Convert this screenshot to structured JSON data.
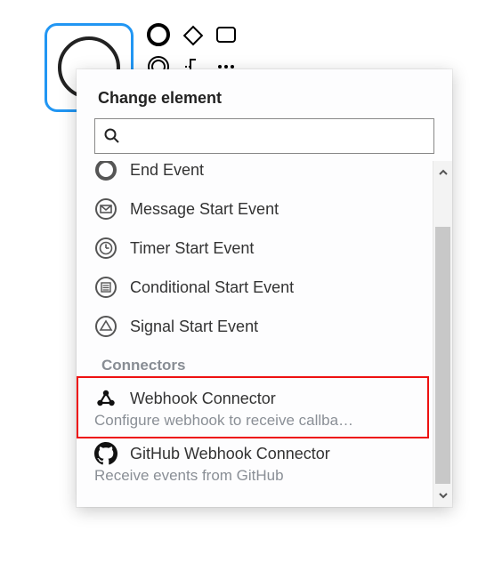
{
  "popup": {
    "title": "Change element",
    "search_placeholder": "",
    "events": [
      {
        "id": "end-event",
        "label": "End Event",
        "icon": "end-event-icon"
      },
      {
        "id": "message-start-event",
        "label": "Message Start Event",
        "icon": "message-start-event-icon"
      },
      {
        "id": "timer-start-event",
        "label": "Timer Start Event",
        "icon": "timer-start-event-icon"
      },
      {
        "id": "conditional-start-event",
        "label": "Conditional Start Event",
        "icon": "conditional-start-event-icon"
      },
      {
        "id": "signal-start-event",
        "label": "Signal Start Event",
        "icon": "signal-start-event-icon"
      }
    ],
    "connectors_section_title": "Connectors",
    "connectors": [
      {
        "id": "webhook-connector",
        "label": "Webhook Connector",
        "desc": "Configure webhook to receive callba…",
        "icon": "webhook-icon"
      },
      {
        "id": "github-webhook-connector",
        "label": "GitHub Webhook Connector",
        "desc": "Receive events from GitHub",
        "icon": "github-icon"
      }
    ],
    "highlighted_item_id": "webhook-connector"
  }
}
